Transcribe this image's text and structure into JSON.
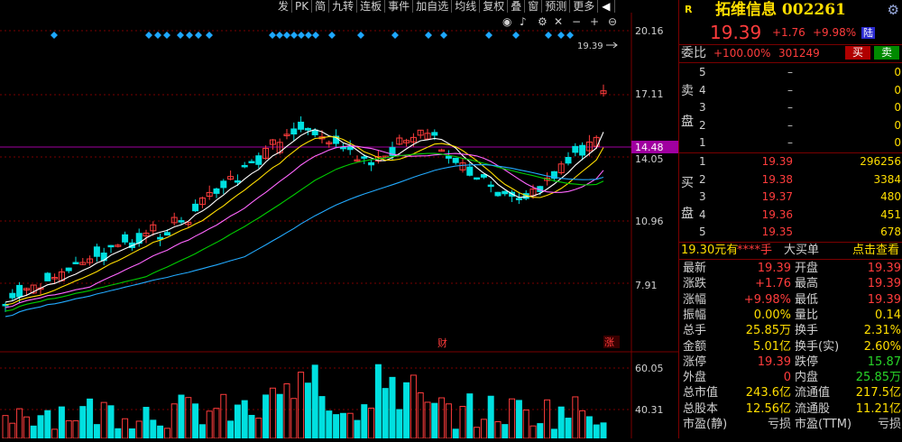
{
  "toolbar": {
    "items": [
      "发",
      "PK",
      "简",
      "九转",
      "连板",
      "事件",
      "加自选",
      "均线",
      "复权",
      "叠",
      "窗",
      "预测",
      "更多",
      "◀"
    ]
  },
  "chart_icons": [
    "eye-icon",
    "bell-icon",
    "settings-icon",
    "cross-icon",
    "minus-icon",
    "plus-icon",
    "collapse-icon"
  ],
  "chart_labels": {
    "price_axis": [
      "20.16",
      "17.11",
      "14.05",
      "10.96",
      "7.91"
    ],
    "current_price_tag": "14.48",
    "last_price_marker": "19.39",
    "event_fin": "财",
    "event_limit": "涨",
    "volume_axis": [
      "60.05",
      "40.31"
    ]
  },
  "colors": {
    "up": "#ff3c3c",
    "down": "#00e0e0",
    "ma5": "#ffffff",
    "ma10": "#ffde00",
    "ma20": "#ff66ff",
    "ma30": "#00cc00",
    "ma60": "#22aaff",
    "grid": "#7a0000",
    "panel_label": "#d0d0d0"
  },
  "quote": {
    "badge": "R",
    "name": "拓维信息 002261",
    "price": "19.39",
    "change": "+1.76",
    "change_pct": "+9.98%",
    "market_tag": "陆",
    "ratio_label": "委比",
    "ratio_value": "+100.00%",
    "ratio_diff": "301249",
    "buy_btn": "买",
    "sell_btn": "卖"
  },
  "sell_side_label": [
    "卖",
    "盘"
  ],
  "buy_side_label": [
    "买",
    "盘"
  ],
  "sell_orders": [
    {
      "level": "5",
      "price": "–",
      "qty": "0"
    },
    {
      "level": "4",
      "price": "–",
      "qty": "0"
    },
    {
      "level": "3",
      "price": "–",
      "qty": "0"
    },
    {
      "level": "2",
      "price": "–",
      "qty": "0"
    },
    {
      "level": "1",
      "price": "–",
      "qty": "0"
    }
  ],
  "buy_orders": [
    {
      "level": "1",
      "price": "19.39",
      "qty": "296256"
    },
    {
      "level": "2",
      "price": "19.38",
      "qty": "3384"
    },
    {
      "level": "3",
      "price": "19.37",
      "qty": "480"
    },
    {
      "level": "4",
      "price": "19.36",
      "qty": "451"
    },
    {
      "level": "5",
      "price": "19.35",
      "qty": "678"
    }
  ],
  "big_order": {
    "price": "19.30元有",
    "hands": "****手",
    "label": "大买单",
    "action": "点击查看"
  },
  "stats": [
    {
      "k1": "最新",
      "v1": "19.39",
      "c1": "red",
      "k2": "开盘",
      "v2": "19.39",
      "c2": "red"
    },
    {
      "k1": "涨跌",
      "v1": "+1.76",
      "c1": "red",
      "k2": "最高",
      "v2": "19.39",
      "c2": "red"
    },
    {
      "k1": "涨幅",
      "v1": "+9.98%",
      "c1": "red",
      "k2": "最低",
      "v2": "19.39",
      "c2": "red"
    },
    {
      "k1": "振幅",
      "v1": "0.00%",
      "c1": "yel",
      "k2": "量比",
      "v2": "0.14",
      "c2": "yel"
    },
    {
      "k1": "总手",
      "v1": "25.85万",
      "c1": "yel",
      "k2": "换手",
      "v2": "2.31%",
      "c2": "yel"
    },
    {
      "k1": "金额",
      "v1": "5.01亿",
      "c1": "yel",
      "k2": "换手(实)",
      "v2": "2.60%",
      "c2": "yel"
    },
    {
      "k1": "涨停",
      "v1": "19.39",
      "c1": "red",
      "k2": "跌停",
      "v2": "15.87",
      "c2": "grn"
    },
    {
      "k1": "外盘",
      "v1": "0",
      "c1": "red",
      "k2": "内盘",
      "v2": "25.85万",
      "c2": "grn"
    },
    {
      "k1": "总市值",
      "v1": "243.6亿",
      "c1": "yel",
      "k2": "流通值",
      "v2": "217.5亿",
      "c2": "yel"
    },
    {
      "k1": "总股本",
      "v1": "12.56亿",
      "c1": "yel",
      "k2": "流通股",
      "v2": "11.21亿",
      "c2": "yel"
    },
    {
      "k1": "市盈(静)",
      "v1": "亏损",
      "c1": "wht",
      "k2": "市盈(TTM)",
      "v2": "亏损",
      "c2": "wht"
    }
  ]
}
